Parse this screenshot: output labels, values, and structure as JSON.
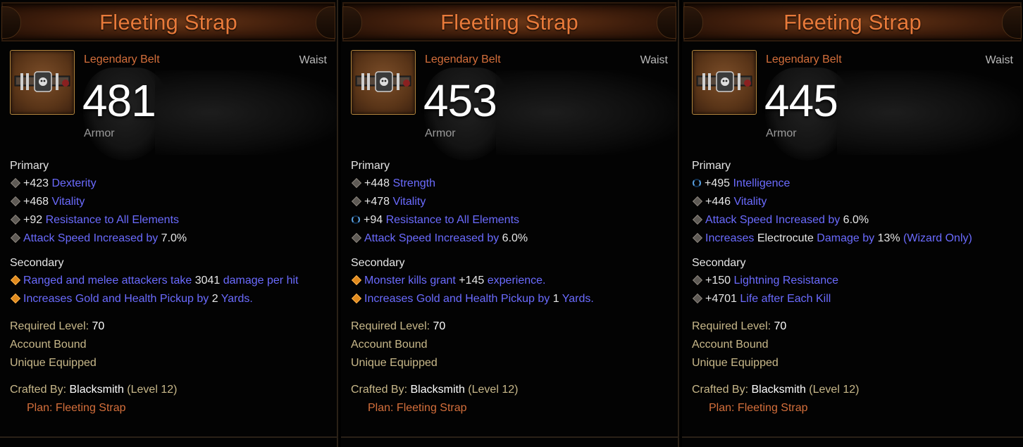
{
  "cards": [
    {
      "title": "Fleeting Strap",
      "item_type": "Legendary Belt",
      "slot": "Waist",
      "armor_value": "481",
      "armor_label": "Armor",
      "primary_label": "Primary",
      "primary": [
        {
          "bullet": "grey",
          "parts": [
            {
              "t": "+423 ",
              "c": "white"
            },
            {
              "t": "Dexterity",
              "c": "blue"
            }
          ]
        },
        {
          "bullet": "grey",
          "parts": [
            {
              "t": "+468 ",
              "c": "white"
            },
            {
              "t": "Vitality",
              "c": "blue"
            }
          ]
        },
        {
          "bullet": "grey",
          "parts": [
            {
              "t": "+92 ",
              "c": "white"
            },
            {
              "t": "Resistance to All Elements",
              "c": "blue"
            }
          ]
        },
        {
          "bullet": "grey",
          "parts": [
            {
              "t": "Attack Speed Increased by ",
              "c": "blue"
            },
            {
              "t": "7.0%",
              "c": "white"
            }
          ]
        }
      ],
      "secondary_label": "Secondary",
      "secondary": [
        {
          "bullet": "orange",
          "parts": [
            {
              "t": "Ranged and melee attackers take ",
              "c": "blue"
            },
            {
              "t": "3041",
              "c": "white"
            },
            {
              "t": " damage per hit",
              "c": "blue"
            }
          ]
        },
        {
          "bullet": "orange",
          "parts": [
            {
              "t": "Increases Gold and Health Pickup by ",
              "c": "blue"
            },
            {
              "t": "2",
              "c": "white"
            },
            {
              "t": " Yards.",
              "c": "blue"
            }
          ]
        }
      ],
      "required_label": "Required Level:",
      "required_value": "70",
      "account_bound": "Account Bound",
      "unique_equipped": "Unique Equipped",
      "crafted_label": "Crafted By:",
      "crafted_by": "Blacksmith",
      "crafted_level": "(Level 12)",
      "plan": "Plan: Fleeting Strap"
    },
    {
      "title": "Fleeting Strap",
      "item_type": "Legendary Belt",
      "slot": "Waist",
      "armor_value": "453",
      "armor_label": "Armor",
      "primary_label": "Primary",
      "primary": [
        {
          "bullet": "grey",
          "parts": [
            {
              "t": "+448 ",
              "c": "white"
            },
            {
              "t": "Strength",
              "c": "blue"
            }
          ]
        },
        {
          "bullet": "grey",
          "parts": [
            {
              "t": "+478 ",
              "c": "white"
            },
            {
              "t": "Vitality",
              "c": "blue"
            }
          ]
        },
        {
          "bullet": "reroll",
          "parts": [
            {
              "t": "+94 ",
              "c": "white"
            },
            {
              "t": "Resistance to All Elements",
              "c": "blue"
            }
          ]
        },
        {
          "bullet": "grey",
          "parts": [
            {
              "t": "Attack Speed Increased by ",
              "c": "blue"
            },
            {
              "t": "6.0%",
              "c": "white"
            }
          ]
        }
      ],
      "secondary_label": "Secondary",
      "secondary": [
        {
          "bullet": "orange",
          "parts": [
            {
              "t": "Monster kills grant ",
              "c": "blue"
            },
            {
              "t": "+145",
              "c": "white"
            },
            {
              "t": " experience.",
              "c": "blue"
            }
          ]
        },
        {
          "bullet": "orange",
          "parts": [
            {
              "t": "Increases Gold and Health Pickup by ",
              "c": "blue"
            },
            {
              "t": "1",
              "c": "white"
            },
            {
              "t": " Yards.",
              "c": "blue"
            }
          ]
        }
      ],
      "required_label": "Required Level:",
      "required_value": "70",
      "account_bound": "Account Bound",
      "unique_equipped": "Unique Equipped",
      "crafted_label": "Crafted By:",
      "crafted_by": "Blacksmith",
      "crafted_level": "(Level 12)",
      "plan": "Plan: Fleeting Strap"
    },
    {
      "title": "Fleeting Strap",
      "item_type": "Legendary Belt",
      "slot": "Waist",
      "armor_value": "445",
      "armor_label": "Armor",
      "primary_label": "Primary",
      "primary": [
        {
          "bullet": "reroll",
          "parts": [
            {
              "t": "+495 ",
              "c": "white"
            },
            {
              "t": "Intelligence",
              "c": "blue"
            }
          ]
        },
        {
          "bullet": "grey",
          "parts": [
            {
              "t": "+446 ",
              "c": "white"
            },
            {
              "t": "Vitality",
              "c": "blue"
            }
          ]
        },
        {
          "bullet": "grey",
          "parts": [
            {
              "t": "Attack Speed Increased by ",
              "c": "blue"
            },
            {
              "t": "6.0%",
              "c": "white"
            }
          ]
        },
        {
          "bullet": "grey",
          "parts": [
            {
              "t": "Increases ",
              "c": "blue"
            },
            {
              "t": "Electrocute",
              "c": "white"
            },
            {
              "t": " Damage by ",
              "c": "blue"
            },
            {
              "t": "13%",
              "c": "white"
            },
            {
              "t": " (Wizard Only)",
              "c": "blue"
            }
          ]
        }
      ],
      "secondary_label": "Secondary",
      "secondary": [
        {
          "bullet": "grey",
          "parts": [
            {
              "t": "+150 ",
              "c": "white"
            },
            {
              "t": "Lightning Resistance",
              "c": "blue"
            }
          ]
        },
        {
          "bullet": "grey",
          "parts": [
            {
              "t": "+4701 ",
              "c": "white"
            },
            {
              "t": "Life after Each Kill",
              "c": "blue"
            }
          ]
        }
      ],
      "required_label": "Required Level:",
      "required_value": "70",
      "account_bound": "Account Bound",
      "unique_equipped": "Unique Equipped",
      "crafted_label": "Crafted By:",
      "crafted_by": "Blacksmith",
      "crafted_level": "(Level 12)",
      "plan": "Plan: Fleeting Strap"
    }
  ],
  "colors": {
    "title": "#e87a3a",
    "item_type": "#d56f3b",
    "affix_blue": "#6b6bff",
    "requirement_tan": "#c8b88a"
  }
}
